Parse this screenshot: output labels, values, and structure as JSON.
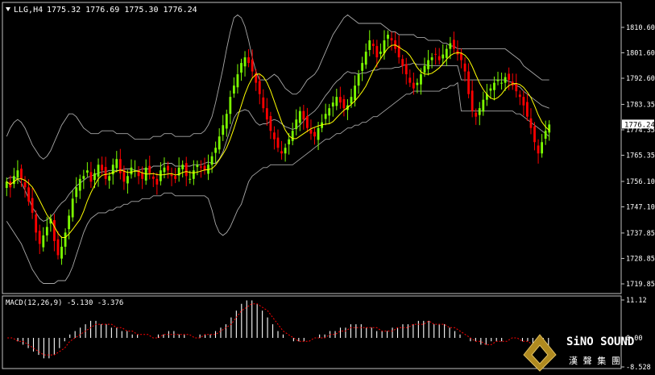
{
  "header": {
    "symbol_label": "LLG,H4",
    "ohlc_label": "1775.32 1776.69 1775.30 1776.24"
  },
  "indicator": {
    "label": "MACD(12,26,9) -5.130 -3.376"
  },
  "colors": {
    "background": "#000000",
    "frame": "#c0c0c0",
    "bull": "#7cfc00",
    "bear": "#ff0000",
    "bands": "#a8a8a8",
    "ma": "#ffff00",
    "histogram": "#ffffff",
    "signal": "#ff0000",
    "text": "#ffffff"
  },
  "logo": {
    "brand": "SiNO SOUND",
    "chinese": "漢 聲 集 團"
  },
  "chart_data": [
    {
      "type": "candlestick",
      "symbol": "LLG",
      "timeframe": "H4",
      "last_price": "1776.24",
      "ylim": [
        1717,
        1818
      ],
      "ticks": [
        "1810.60",
        "1801.60",
        "1792.60",
        "1783.35",
        "1774.35",
        "1765.35",
        "1756.10",
        "1747.10",
        "1737.85",
        "1728.85",
        "1719.85"
      ],
      "tick_values": [
        1810.6,
        1801.6,
        1792.6,
        1783.35,
        1774.35,
        1765.35,
        1756.1,
        1747.1,
        1737.85,
        1728.85,
        1719.85
      ],
      "overlays": [
        "Bollinger Bands",
        "Moving Average"
      ],
      "close": [
        1756,
        1754,
        1758,
        1760,
        1757,
        1754,
        1749,
        1745,
        1738,
        1734,
        1737,
        1740,
        1743,
        1735,
        1730,
        1733,
        1738,
        1744,
        1750,
        1754,
        1757,
        1758,
        1760,
        1756,
        1759,
        1762,
        1760,
        1757,
        1758,
        1762,
        1764,
        1759,
        1756,
        1758,
        1761,
        1760,
        1758,
        1757,
        1761,
        1759,
        1757,
        1755,
        1760,
        1761,
        1760,
        1758,
        1757,
        1761,
        1762,
        1758,
        1757,
        1760,
        1762,
        1761,
        1760,
        1762,
        1765,
        1768,
        1772,
        1776,
        1780,
        1786,
        1790,
        1794,
        1798,
        1800,
        1798,
        1795,
        1791,
        1787,
        1782,
        1778,
        1774,
        1771,
        1768,
        1766,
        1768,
        1771,
        1774,
        1778,
        1781,
        1778,
        1775,
        1773,
        1772,
        1775,
        1777,
        1780,
        1782,
        1784,
        1786,
        1784,
        1782,
        1783,
        1786,
        1790,
        1794,
        1798,
        1802,
        1806,
        1804,
        1800,
        1802,
        1806,
        1808,
        1806,
        1803,
        1800,
        1797,
        1794,
        1791,
        1789,
        1791,
        1794,
        1797,
        1799,
        1800,
        1801,
        1799,
        1801,
        1803,
        1805,
        1803,
        1801,
        1799,
        1795,
        1787,
        1781,
        1779,
        1782,
        1785,
        1787,
        1789,
        1791,
        1792,
        1791,
        1793,
        1792,
        1790,
        1788,
        1786,
        1783,
        1779,
        1775,
        1770,
        1766,
        1770,
        1774,
        1776.24
      ],
      "bb_upper": [
        1772,
        1775,
        1777,
        1778,
        1777,
        1775,
        1772,
        1769,
        1767,
        1765,
        1764,
        1765,
        1767,
        1770,
        1773,
        1776,
        1778,
        1780,
        1780,
        1779,
        1777,
        1775,
        1774,
        1773,
        1773,
        1773,
        1774,
        1774,
        1774,
        1774,
        1773,
        1773,
        1773,
        1773,
        1772,
        1771,
        1771,
        1771,
        1771,
        1771,
        1772,
        1772,
        1772,
        1773,
        1773,
        1773,
        1772,
        1772,
        1772,
        1772,
        1772,
        1773,
        1773,
        1773,
        1774,
        1776,
        1779,
        1784,
        1790,
        1796,
        1803,
        1809,
        1814,
        1815,
        1814,
        1811,
        1806,
        1800,
        1795,
        1792,
        1792,
        1792,
        1793,
        1794,
        1793,
        1791,
        1789,
        1788,
        1787,
        1787,
        1788,
        1790,
        1792,
        1793,
        1794,
        1796,
        1799,
        1802,
        1805,
        1808,
        1810,
        1812,
        1814,
        1815,
        1814,
        1813,
        1812,
        1812,
        1812,
        1812,
        1812,
        1812,
        1812,
        1811,
        1810,
        1809,
        1809,
        1808,
        1808,
        1808,
        1808,
        1808,
        1807,
        1807,
        1807,
        1806,
        1806,
        1806,
        1806,
        1805,
        1805,
        1804,
        1804,
        1803,
        1803,
        1803,
        1803,
        1803,
        1803,
        1803,
        1803,
        1803,
        1803,
        1803,
        1803,
        1803,
        1803,
        1802,
        1801,
        1800,
        1799,
        1797,
        1796,
        1795,
        1794,
        1793,
        1792,
        1792,
        1792
      ],
      "bb_lower": [
        1742,
        1740,
        1738,
        1736,
        1734,
        1731,
        1728,
        1725,
        1723,
        1721,
        1720,
        1720,
        1720,
        1720,
        1721,
        1721,
        1721,
        1723,
        1726,
        1730,
        1734,
        1738,
        1741,
        1743,
        1744,
        1745,
        1745,
        1745,
        1746,
        1746,
        1747,
        1747,
        1748,
        1748,
        1749,
        1749,
        1749,
        1750,
        1750,
        1750,
        1751,
        1751,
        1751,
        1752,
        1752,
        1752,
        1751,
        1751,
        1751,
        1751,
        1751,
        1751,
        1751,
        1751,
        1751,
        1750,
        1746,
        1741,
        1738,
        1737,
        1738,
        1740,
        1743,
        1746,
        1748,
        1752,
        1756,
        1758,
        1759,
        1760,
        1761,
        1761,
        1762,
        1762,
        1762,
        1762,
        1762,
        1762,
        1762,
        1763,
        1764,
        1765,
        1766,
        1767,
        1768,
        1769,
        1770,
        1771,
        1771,
        1772,
        1773,
        1773,
        1774,
        1775,
        1775,
        1776,
        1776,
        1777,
        1777,
        1778,
        1779,
        1779,
        1780,
        1781,
        1782,
        1783,
        1784,
        1785,
        1786,
        1787,
        1787,
        1788,
        1788,
        1788,
        1788,
        1788,
        1788,
        1788,
        1788,
        1789,
        1789,
        1790,
        1790,
        1791,
        1781,
        1781,
        1781,
        1781,
        1781,
        1781,
        1781,
        1781,
        1781,
        1781,
        1781,
        1781,
        1781,
        1781,
        1781,
        1780,
        1780,
        1779,
        1778,
        1777,
        1776,
        1775,
        1774,
        1773,
        1772
      ]
    },
    {
      "type": "macd",
      "params": "12,26,9",
      "ylim": [
        -8.528,
        11.12
      ],
      "ticks": [
        "11.12",
        "0.00",
        "-8.528"
      ],
      "tick_values": [
        11.12,
        0,
        -8.528
      ],
      "macd": [
        0,
        0,
        -1,
        -2,
        -3,
        -4,
        -5,
        -6,
        -6,
        -5,
        -3,
        -1,
        1,
        2,
        3,
        4,
        5,
        5,
        4,
        4,
        3,
        3,
        2,
        2,
        1,
        1,
        0,
        0,
        0,
        1,
        1,
        2,
        2,
        1,
        1,
        0,
        0,
        1,
        1,
        1,
        2,
        3,
        4,
        6,
        8,
        10,
        11,
        11,
        10,
        8,
        6,
        4,
        2,
        1,
        0,
        -1,
        -1,
        -1,
        0,
        0,
        1,
        1,
        2,
        2,
        3,
        3,
        4,
        4,
        4,
        3,
        3,
        2,
        2,
        2,
        3,
        3,
        4,
        4,
        4,
        5,
        5,
        5,
        4,
        4,
        4,
        3,
        2,
        1,
        0,
        -1,
        -1,
        -2,
        -2,
        -1,
        -1,
        -1,
        0,
        0,
        0,
        -1,
        -1,
        -2,
        -3,
        -4,
        -5
      ],
      "signal": [
        0,
        0,
        -1,
        -1,
        -2,
        -3,
        -4,
        -5,
        -5,
        -5,
        -4,
        -3,
        -1,
        0,
        1,
        2,
        3,
        4,
        4,
        4,
        4,
        3,
        3,
        2,
        2,
        1,
        1,
        1,
        0,
        0,
        1,
        1,
        1,
        1,
        1,
        1,
        0,
        0,
        1,
        1,
        1,
        2,
        3,
        4,
        6,
        8,
        9,
        10,
        10,
        9,
        8,
        6,
        4,
        2,
        1,
        0,
        -1,
        -1,
        -1,
        0,
        0,
        0,
        1,
        1,
        2,
        2,
        3,
        3,
        3,
        3,
        3,
        3,
        2,
        2,
        2,
        3,
        3,
        3,
        4,
        4,
        4,
        5,
        4,
        4,
        4,
        3,
        3,
        2,
        1,
        0,
        -1,
        -1,
        -2,
        -2,
        -1,
        -1,
        -1,
        0,
        0,
        -1,
        -1,
        -2,
        -2,
        -3,
        -3
      ]
    }
  ]
}
